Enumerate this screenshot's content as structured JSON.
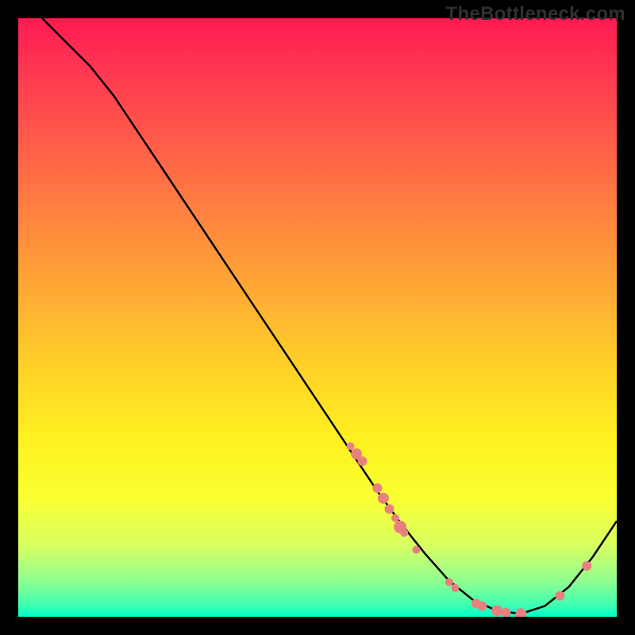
{
  "watermark": "TheBottleneck.com",
  "chart_data": {
    "type": "line",
    "title": "",
    "xlabel": "",
    "ylabel": "",
    "xlim": [
      0,
      100
    ],
    "ylim": [
      0,
      100
    ],
    "series": [
      {
        "name": "bottleneck-curve",
        "color": "#000000",
        "x": [
          4,
          8,
          12,
          16,
          20,
          24,
          28,
          32,
          36,
          40,
          44,
          48,
          52,
          56,
          60,
          64,
          68,
          72,
          76,
          80,
          84,
          88,
          92,
          96,
          100
        ],
        "y": [
          100,
          96,
          92,
          87,
          81,
          75,
          69,
          63,
          57,
          51,
          45,
          39,
          33,
          27,
          21,
          15.5,
          10.5,
          6,
          2.8,
          1,
          0.5,
          1.8,
          5,
          10,
          16
        ]
      }
    ],
    "scatter_points": {
      "name": "highlight-dots",
      "color": "#e88080",
      "points": [
        {
          "x": 55.5,
          "y": 28.5,
          "r": 5
        },
        {
          "x": 56.5,
          "y": 27.2,
          "r": 7
        },
        {
          "x": 57.5,
          "y": 26.0,
          "r": 6
        },
        {
          "x": 60.0,
          "y": 21.5,
          "r": 6
        },
        {
          "x": 61.0,
          "y": 19.8,
          "r": 7
        },
        {
          "x": 62.0,
          "y": 18.0,
          "r": 6
        },
        {
          "x": 63.0,
          "y": 16.5,
          "r": 5
        },
        {
          "x": 63.8,
          "y": 15.0,
          "r": 8
        },
        {
          "x": 64.5,
          "y": 14.0,
          "r": 5
        },
        {
          "x": 66.5,
          "y": 11.2,
          "r": 5
        },
        {
          "x": 72.0,
          "y": 5.8,
          "r": 5
        },
        {
          "x": 73.0,
          "y": 4.8,
          "r": 5
        },
        {
          "x": 76.5,
          "y": 2.2,
          "r": 6
        },
        {
          "x": 77.5,
          "y": 1.8,
          "r": 6
        },
        {
          "x": 80.0,
          "y": 1.0,
          "r": 7
        },
        {
          "x": 81.5,
          "y": 0.7,
          "r": 6
        },
        {
          "x": 84.0,
          "y": 0.5,
          "r": 7
        },
        {
          "x": 90.5,
          "y": 3.5,
          "r": 6
        },
        {
          "x": 95.0,
          "y": 8.5,
          "r": 6
        }
      ]
    }
  }
}
